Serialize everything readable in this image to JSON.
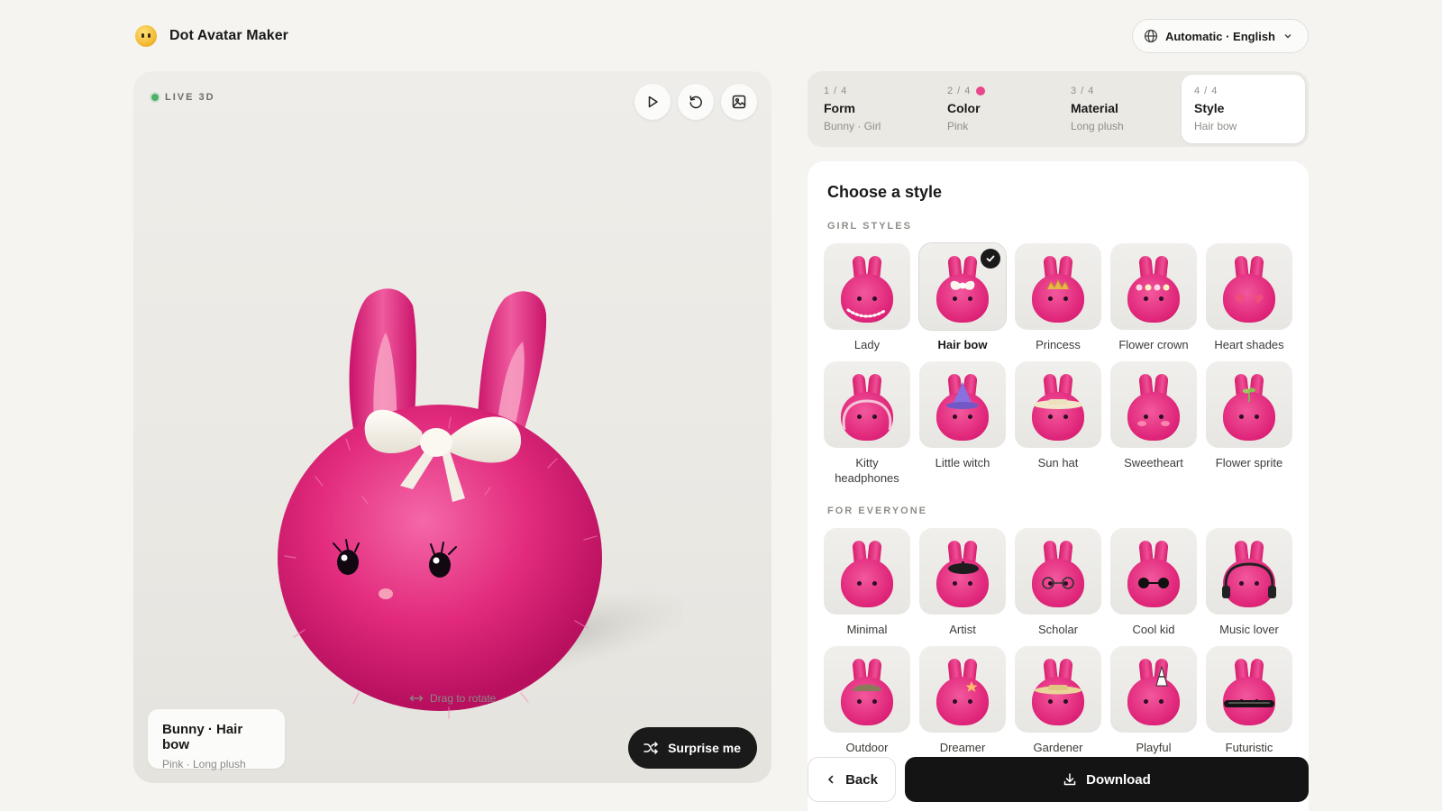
{
  "app": {
    "title": "Dot Avatar Maker",
    "brand_icon": "smiley-face-icon"
  },
  "language": {
    "label": "Automatic · English",
    "icon": "globe-icon"
  },
  "preview": {
    "live_label": "LIVE 3D",
    "rotate_hint": "Drag to rotate",
    "card_title": "Bunny · Hair bow",
    "card_sub": "Pink · Long plush",
    "surprise_label": "Surprise me",
    "colors": {
      "fur": "#e5287b",
      "bow": "#f8f4ec",
      "live": "#4caf6a"
    }
  },
  "steps": [
    {
      "num": "1 / 4",
      "name": "Form",
      "value": "Bunny · Girl",
      "active": false,
      "dot": false
    },
    {
      "num": "2 / 4",
      "name": "Color",
      "value": "Pink",
      "active": false,
      "dot": true
    },
    {
      "num": "3 / 4",
      "name": "Material",
      "value": "Long plush",
      "active": false,
      "dot": false
    },
    {
      "num": "4 / 4",
      "name": "Style",
      "value": "Hair bow",
      "active": true,
      "dot": false
    }
  ],
  "panel": {
    "title": "Choose a style",
    "sections": [
      {
        "label": "GIRL STYLES",
        "items": [
          {
            "name": "Lady",
            "acc": "pearls",
            "selected": false
          },
          {
            "name": "Hair bow",
            "acc": "bow",
            "selected": true
          },
          {
            "name": "Princess",
            "acc": "tiara",
            "selected": false
          },
          {
            "name": "Flower crown",
            "acc": "flowers",
            "selected": false
          },
          {
            "name": "Heart shades",
            "acc": "hearts",
            "selected": false
          },
          {
            "name": "Kitty headphones",
            "acc": "kitty",
            "selected": false
          },
          {
            "name": "Little witch",
            "acc": "witch",
            "selected": false
          },
          {
            "name": "Sun hat",
            "acc": "sunhat",
            "selected": false
          },
          {
            "name": "Sweetheart",
            "acc": "blush",
            "selected": false
          },
          {
            "name": "Flower sprite",
            "acc": "sprout",
            "selected": false
          }
        ]
      },
      {
        "label": "FOR EVERYONE",
        "items": [
          {
            "name": "Minimal",
            "acc": "none",
            "selected": false
          },
          {
            "name": "Artist",
            "acc": "beret",
            "selected": false
          },
          {
            "name": "Scholar",
            "acc": "glasses",
            "selected": false
          },
          {
            "name": "Cool kid",
            "acc": "shades",
            "selected": false
          },
          {
            "name": "Music lover",
            "acc": "headphones",
            "selected": false
          },
          {
            "name": "Outdoor",
            "acc": "cap",
            "selected": false
          },
          {
            "name": "Dreamer",
            "acc": "star",
            "selected": false
          },
          {
            "name": "Gardener",
            "acc": "strawhat",
            "selected": false
          },
          {
            "name": "Playful",
            "acc": "party",
            "selected": false
          },
          {
            "name": "Futuristic",
            "acc": "visor",
            "selected": false
          }
        ]
      }
    ]
  },
  "footer": {
    "back_label": "Back",
    "download_label": "Download"
  }
}
